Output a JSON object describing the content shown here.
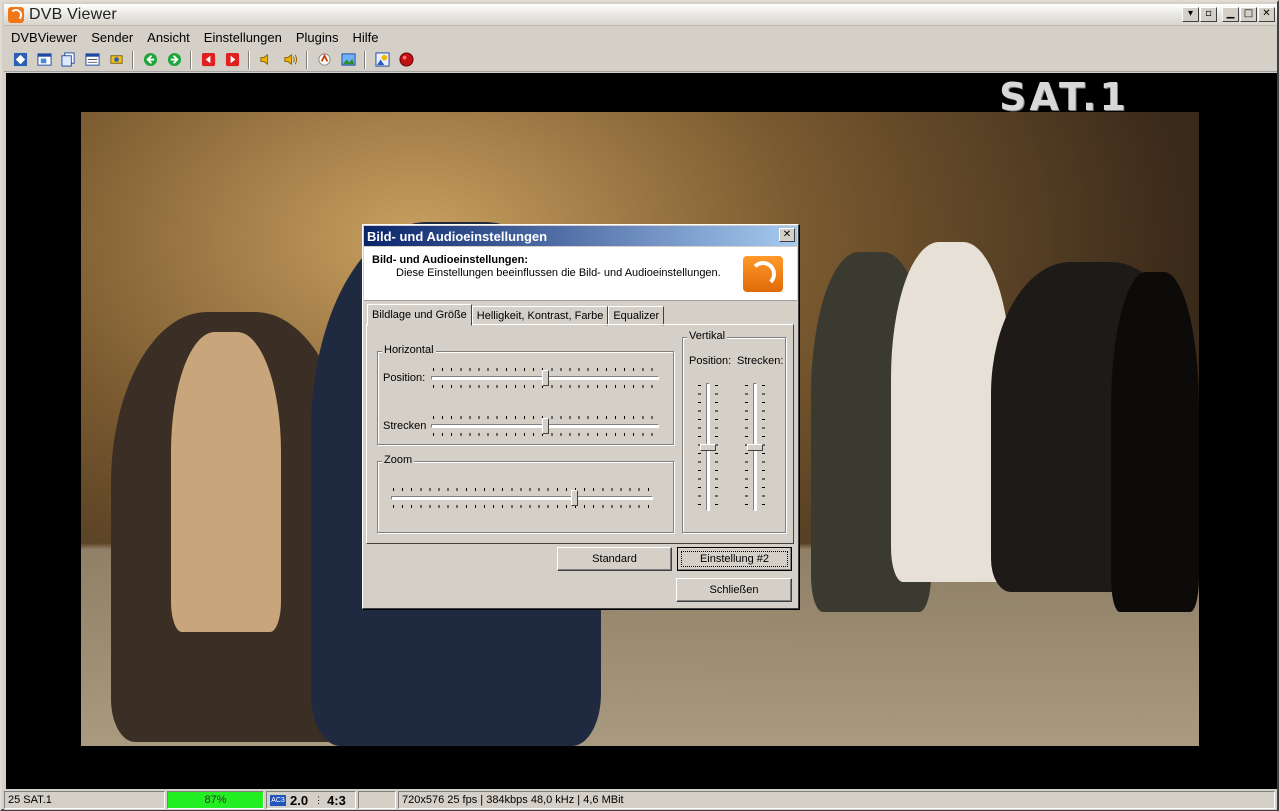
{
  "window": {
    "title": "DVB Viewer",
    "controls": [
      "▾",
      "▫",
      "▁",
      "□",
      "✕"
    ]
  },
  "menu": [
    {
      "label": "DVBViewer"
    },
    {
      "label": "Sender"
    },
    {
      "label": "Ansicht"
    },
    {
      "label": "Einstellungen"
    },
    {
      "label": "Plugins"
    },
    {
      "label": "Hilfe"
    }
  ],
  "toolbar": {
    "icons": [
      "channel-list-icon",
      "tv-window-icon",
      "copy-window-icon",
      "epg-icon",
      "recorder-icon",
      "back-icon",
      "forward-icon",
      "prev-channel-icon",
      "next-channel-icon",
      "volume-down-icon",
      "volume-up-icon",
      "audio-icon",
      "picture-icon",
      "snapshot-icon",
      "record-icon"
    ]
  },
  "video": {
    "channel_logo": "SAT.1"
  },
  "dialog": {
    "title": "Bild- und Audioeinstellungen",
    "close": "✕",
    "header_title": "Bild- und Audioeinstellungen:",
    "header_desc": "Diese Einstellungen beeinflussen die Bild- und Audioeinstellungen.",
    "tabs": [
      {
        "label": "Bildlage und Größe",
        "active": true
      },
      {
        "label": "Helligkeit, Kontrast, Farbe",
        "active": false
      },
      {
        "label": "Equalizer",
        "active": false
      }
    ],
    "horizontal": {
      "label": "Horizontal",
      "position_label": "Position:",
      "stretch_label": "Strecken",
      "position_value": 0.5,
      "stretch_value": 0.5
    },
    "zoom": {
      "label": "Zoom",
      "value": 0.7
    },
    "vertical": {
      "label": "Vertikal",
      "position_label": "Position:",
      "stretch_label": "Strecken:",
      "position_value": 0.5,
      "stretch_value": 0.5
    },
    "buttons": {
      "standard": "Standard",
      "preset": "Einstellung #2",
      "close": "Schließen"
    }
  },
  "statusbar": {
    "channel": "25 SAT.1",
    "signal": "87%",
    "signal_color": "#22ee22",
    "audio_format_icon": "AC3",
    "audio_channels": "2.0",
    "aspect": "4:3",
    "stream_info": "720x576 25 fps | 384kbps 48,0 kHz | 4,6 MBit"
  }
}
